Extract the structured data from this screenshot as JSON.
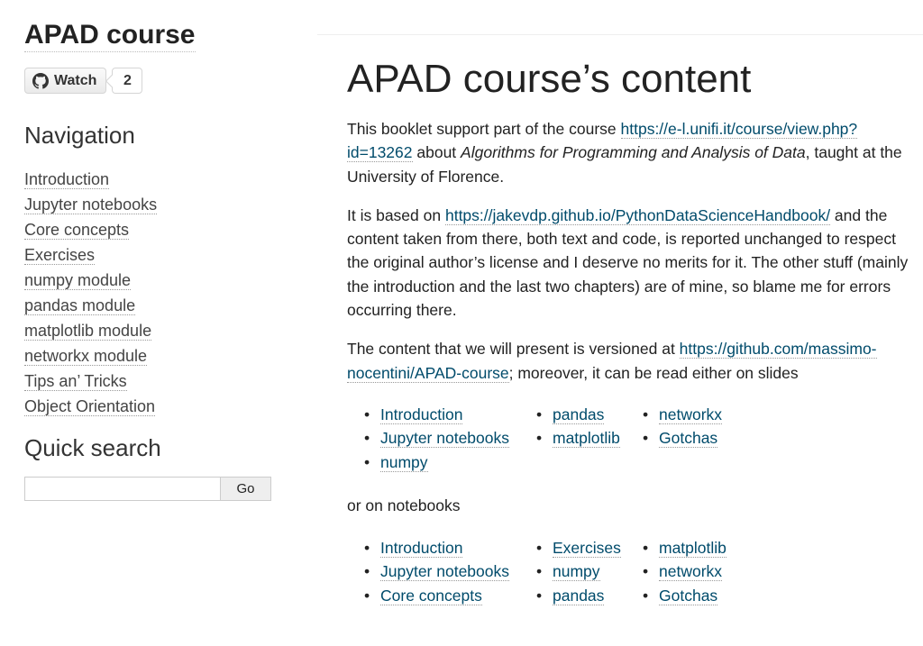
{
  "sidebar": {
    "title": "APAD course",
    "github": {
      "watch_label": "Watch",
      "count": "2"
    },
    "nav_heading": "Navigation",
    "nav_items": [
      "Introduction",
      "Jupyter notebooks",
      "Core concepts",
      "Exercises",
      "numpy module",
      "pandas module",
      "matplotlib module",
      "networkx module",
      "Tips an’ Tricks",
      "Object Orientation"
    ],
    "search_heading": "Quick search",
    "search_button": "Go"
  },
  "main": {
    "title": "APAD course’s content",
    "p1": {
      "t1": "This booklet support part of the course ",
      "link": "https://e-l.unifi.it/course/view.php?id=13262",
      "t2": " about ",
      "em": "Algorithms for Programming and Analysis of Data",
      "t3": ", taught at the University of Florence."
    },
    "p2": {
      "t1": "It is based on ",
      "link": "https://jakevdp.github.io/PythonDataScienceHandbook/",
      "t2": " and the content taken from there, both text and code, is reported unchanged to respect the original author’s license and I deserve no merits for it. The other stuff (mainly the introduction and the last two chapters) are of mine, so blame me for errors occurring there."
    },
    "p3": {
      "t1": "The content that we will present is versioned at ",
      "link": "https://github.com/massimo-nocentini/APAD-course",
      "t2": "; moreover, it can be read either on slides"
    },
    "slides_links": [
      [
        "Introduction",
        "Jupyter notebooks",
        "numpy"
      ],
      [
        "pandas",
        "matplotlib"
      ],
      [
        "networkx",
        "Gotchas"
      ]
    ],
    "p4": "or on notebooks",
    "notebooks_links": [
      [
        "Introduction",
        "Jupyter notebooks",
        "Core concepts"
      ],
      [
        "Exercises",
        "numpy",
        "pandas"
      ],
      [
        "matplotlib",
        "networkx",
        "Gotchas"
      ]
    ]
  }
}
